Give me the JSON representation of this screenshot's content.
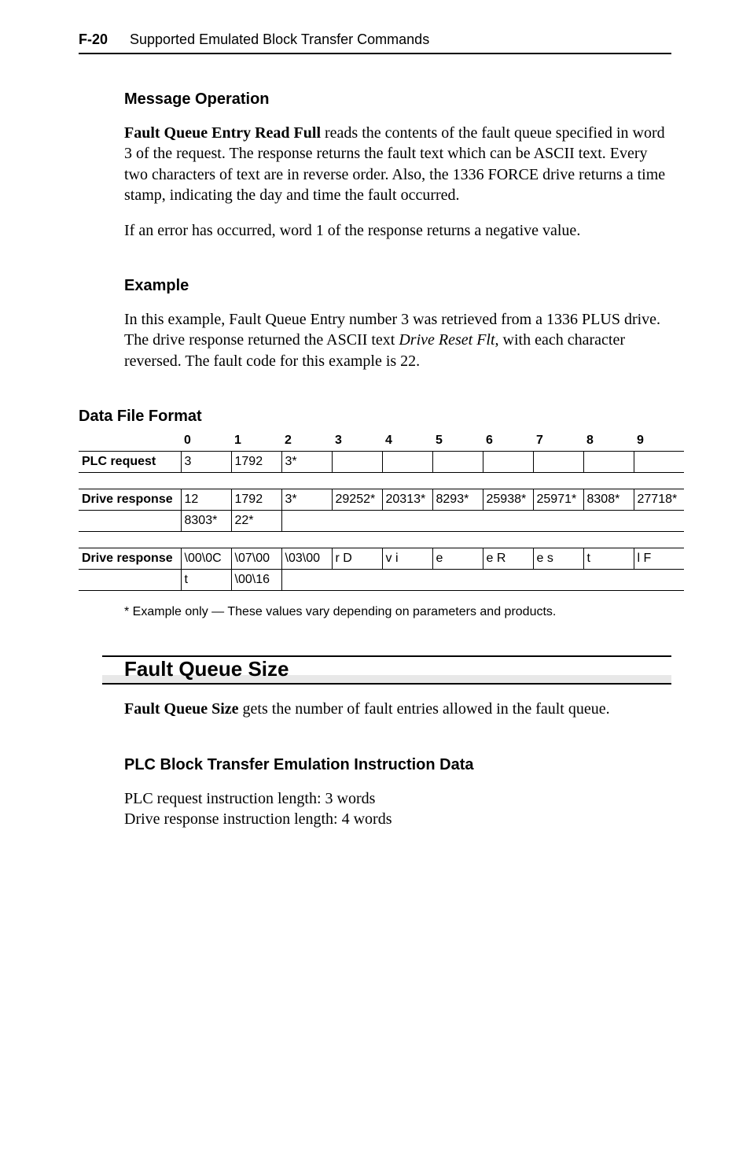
{
  "header": {
    "page_no": "F-20",
    "title": "Supported Emulated Block Transfer Commands"
  },
  "sec1": {
    "heading": "Message Operation",
    "p1_lead": "Fault Queue Entry Read Full",
    "p1_rest": " reads the contents of the fault queue specified in word 3 of the request. The response returns the fault text which can be ASCII text. Every two characters of text are in reverse order. Also, the 1336 FORCE drive returns a time stamp, indicating the day and time the fault occurred.",
    "p2": "If an error has occurred, word 1 of the response returns a negative value."
  },
  "sec2": {
    "heading": "Example",
    "p1a": "In this example, Fault Queue Entry number 3 was retrieved from a 1336 PLUS drive. The drive response returned the ASCII text ",
    "p1i": "Drive Reset Flt",
    "p1b": ", with each character reversed. The fault code for this example is 22."
  },
  "sec3": {
    "heading": "Data File Format",
    "cols": [
      "0",
      "1",
      "2",
      "3",
      "4",
      "5",
      "6",
      "7",
      "8",
      "9"
    ],
    "plc_label": "PLC request",
    "plc": {
      "c0": "3",
      "c1": "1792",
      "c2": "3*",
      "c3": "",
      "c4": "",
      "c5": "",
      "c6": "",
      "c7": "",
      "c8": "",
      "c9": ""
    },
    "dr1_label": "Drive response",
    "dr1a": {
      "c0": "12",
      "c1": "1792",
      "c2": "3*",
      "c3": "29252*",
      "c4": "20313*",
      "c5": "8293*",
      "c6": "25938*",
      "c7": "25971*",
      "c8": "8308*",
      "c9": "27718*"
    },
    "dr1b": {
      "c0": "8303*",
      "c1": "22*",
      "c2": "",
      "c3": "",
      "c4": "",
      "c5": "",
      "c6": "",
      "c7": "",
      "c8": "",
      "c9": ""
    },
    "dr2_label": "Drive response",
    "dr2a": {
      "c0": "\\00\\0C",
      "c1": "\\07\\00",
      "c2": "\\03\\00",
      "c3": "r D",
      "c4": "v i",
      "c5": "e",
      "c6": "e R",
      "c7": "e s",
      "c8": "t",
      "c9": "l F"
    },
    "dr2b": {
      "c0": "t",
      "c1": "\\00\\16",
      "c2": "",
      "c3": "",
      "c4": "",
      "c5": "",
      "c6": "",
      "c7": "",
      "c8": "",
      "c9": ""
    },
    "footnote": "* Example only — These values vary depending on parameters and products."
  },
  "feature": {
    "heading": "Fault Queue Size",
    "p_lead": "Fault Queue Size",
    "p_rest": " gets the number of fault entries allowed in the fault queue."
  },
  "sec4": {
    "heading": "PLC Block Transfer Emulation Instruction Data",
    "l1": "PLC request instruction length: 3 words",
    "l2": "Drive response instruction length: 4 words"
  }
}
